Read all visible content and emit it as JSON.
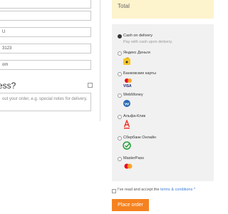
{
  "billing": {
    "field_values": [
      "",
      "",
      "U",
      "3123",
      "om"
    ]
  },
  "additional": {
    "heading": "ess?",
    "notes_placeholder": "out your order, e.g. special notes for delivery."
  },
  "order": {
    "total_label": "Total"
  },
  "payment": {
    "methods": [
      {
        "label": "Cash on delivery",
        "description": "Pay with cash upon delivery.",
        "selected": true
      },
      {
        "label": "Яндекс Деньги"
      },
      {
        "label": "Банковские карты"
      },
      {
        "label": "WebMoney"
      },
      {
        "label": "Альфа-Клик"
      },
      {
        "label": "Сбербанк Онлайн"
      },
      {
        "label": "MasterPass"
      }
    ]
  },
  "terms": {
    "prefix": "I've read and accept the",
    "link": "terms & conditions",
    "suffix": "*"
  },
  "place_order_label": "Place order",
  "colors": {
    "accent": "#f58220",
    "link": "#3b7dd8",
    "total_bg": "#fdf3cd",
    "panel_bg": "#f1f1f1"
  }
}
